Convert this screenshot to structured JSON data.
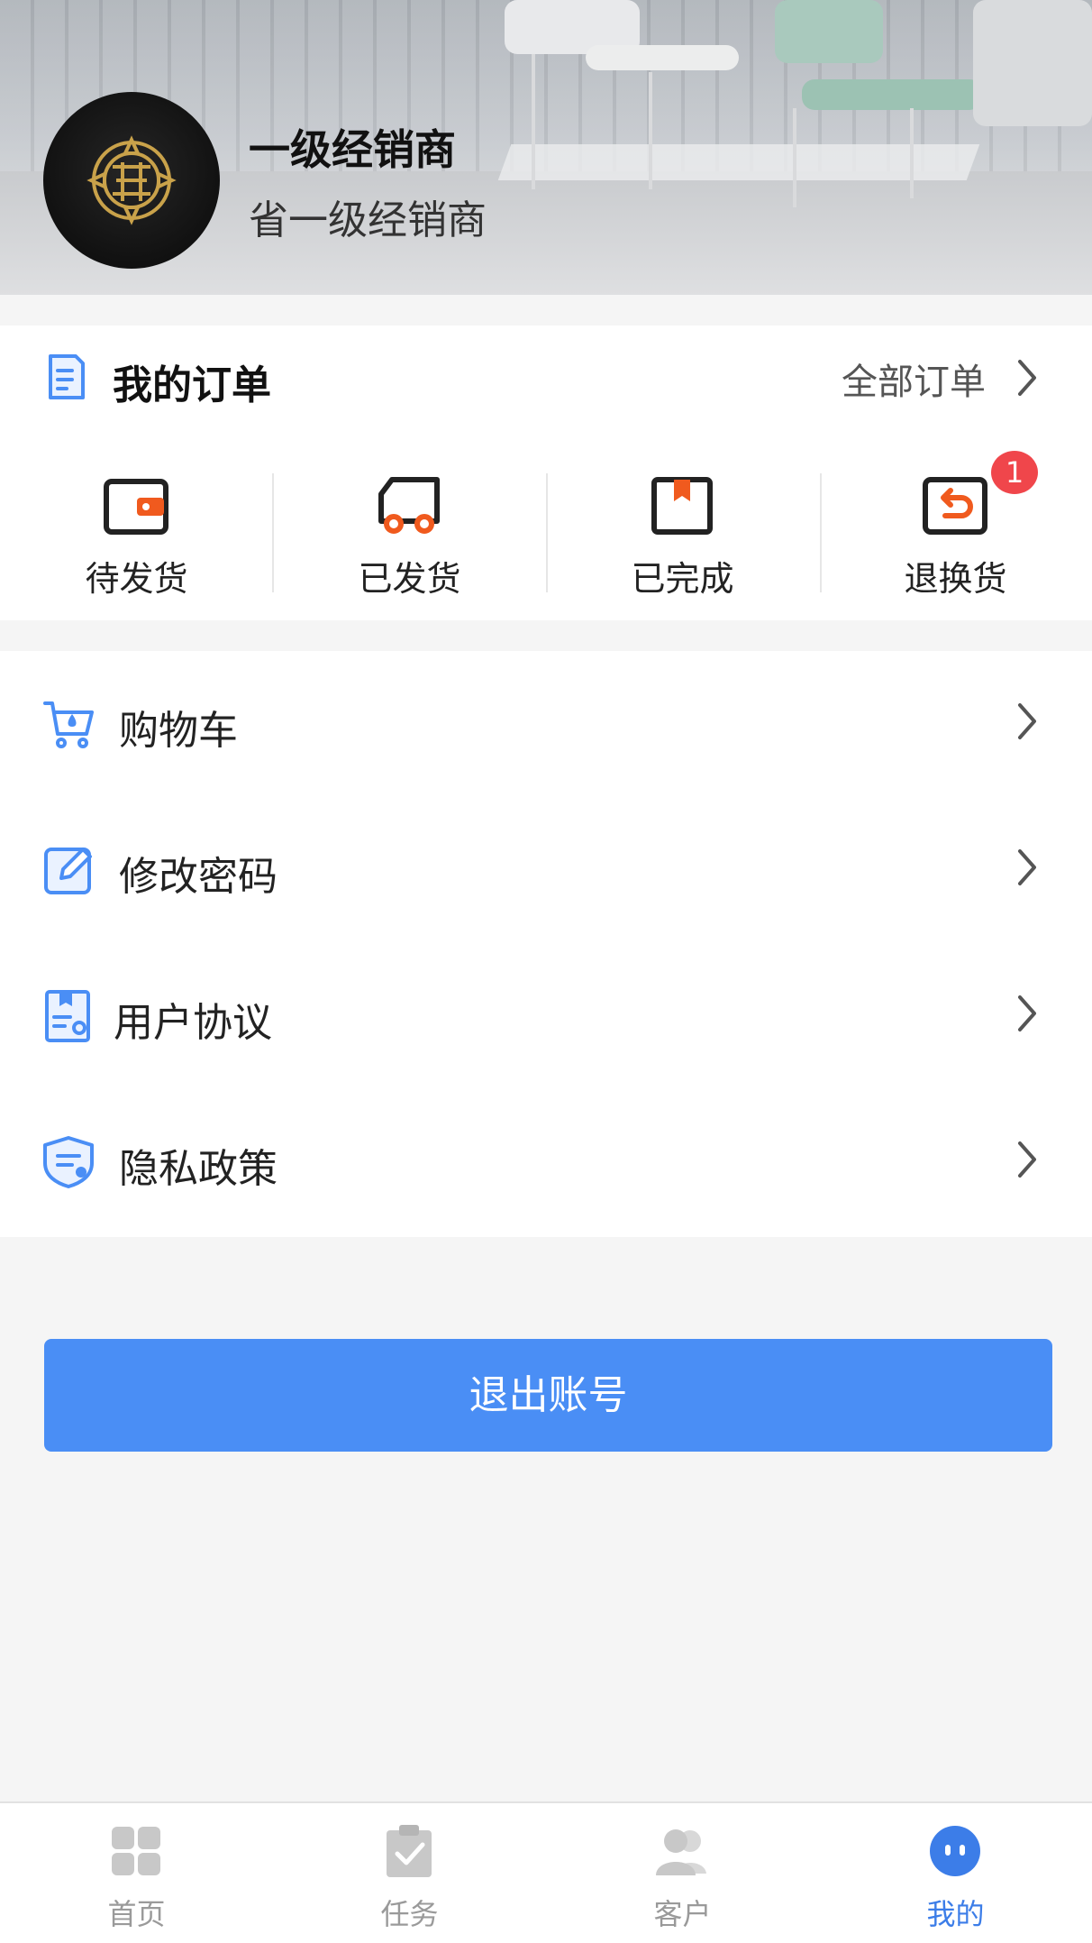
{
  "profile": {
    "name": "一级经销商",
    "role": "省一级经销商"
  },
  "orders": {
    "title": "我的订单",
    "all_label": "全部订单",
    "items": [
      {
        "label": "待发货",
        "icon": "wallet-icon"
      },
      {
        "label": "已发货",
        "icon": "truck-icon"
      },
      {
        "label": "已完成",
        "icon": "bookmark-box-icon"
      },
      {
        "label": "退换货",
        "icon": "return-icon",
        "badge": "1"
      }
    ]
  },
  "menu": {
    "items": [
      {
        "label": "购物车",
        "icon": "cart-icon"
      },
      {
        "label": "修改密码",
        "icon": "edit-icon"
      },
      {
        "label": "用户协议",
        "icon": "document-icon"
      },
      {
        "label": "隐私政策",
        "icon": "shield-icon"
      }
    ]
  },
  "logout_label": "退出账号",
  "tabbar": {
    "items": [
      {
        "label": "首页",
        "icon": "grid-icon",
        "active": false
      },
      {
        "label": "任务",
        "icon": "clipboard-check-icon",
        "active": false
      },
      {
        "label": "客户",
        "icon": "users-icon",
        "active": false
      },
      {
        "label": "我的",
        "icon": "profile-bubble-icon",
        "active": true
      }
    ]
  },
  "colors": {
    "accent": "#4a8ef5",
    "tab_active": "#3c7de8",
    "badge": "#f0464b",
    "icon_orange": "#f05a1e"
  }
}
